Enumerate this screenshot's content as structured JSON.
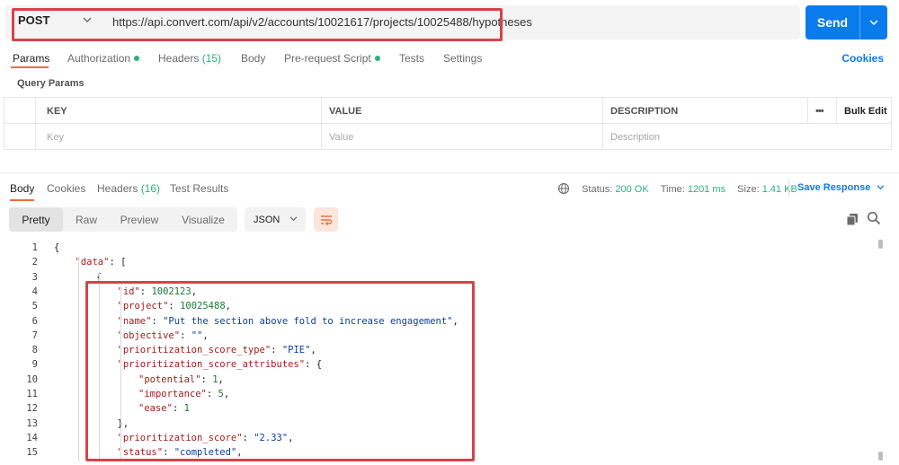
{
  "request": {
    "method": "POST",
    "url": "https://api.convert.com/api/v2/accounts/10021617/projects/10025488/hypotheses",
    "send_label": "Send"
  },
  "request_tabs": [
    {
      "label": "Params",
      "active": true
    },
    {
      "label": "Authorization",
      "dot": true
    },
    {
      "label": "Headers",
      "count": "(15)"
    },
    {
      "label": "Body"
    },
    {
      "label": "Pre-request Script",
      "dot": true
    },
    {
      "label": "Tests"
    },
    {
      "label": "Settings"
    }
  ],
  "cookies_label": "Cookies",
  "query_params": {
    "title": "Query Params",
    "columns": [
      "KEY",
      "VALUE",
      "DESCRIPTION"
    ],
    "more": "•••",
    "bulk_edit": "Bulk Edit",
    "placeholders": [
      "Key",
      "Value",
      "Description"
    ]
  },
  "response_tabs": [
    {
      "label": "Body",
      "active": true
    },
    {
      "label": "Cookies"
    },
    {
      "label": "Headers",
      "count": "(16)"
    },
    {
      "label": "Test Results"
    }
  ],
  "response_status": {
    "status_label": "Status:",
    "status_value": "200 OK",
    "time_label": "Time:",
    "time_value": "1201 ms",
    "size_label": "Size:",
    "size_value": "1.41 KB",
    "save_label": "Save Response"
  },
  "views": [
    "Pretty",
    "Raw",
    "Preview",
    "Visualize"
  ],
  "format": "JSON",
  "code_lines": [
    {
      "n": "1",
      "indent": 0,
      "parts": [
        [
          "p",
          "{"
        ]
      ]
    },
    {
      "n": "2",
      "indent": 1,
      "parts": [
        [
          "k",
          "\"data\""
        ],
        [
          "p",
          ": ["
        ]
      ]
    },
    {
      "n": "3",
      "indent": 2,
      "parts": [
        [
          "p",
          "{"
        ]
      ]
    },
    {
      "n": "4",
      "indent": 3,
      "parts": [
        [
          "k",
          "\"id\""
        ],
        [
          "p",
          ": "
        ],
        [
          "n",
          "1002123"
        ],
        [
          "p",
          ","
        ]
      ]
    },
    {
      "n": "5",
      "indent": 3,
      "parts": [
        [
          "k",
          "\"project\""
        ],
        [
          "p",
          ": "
        ],
        [
          "n",
          "10025488"
        ],
        [
          "p",
          ","
        ]
      ]
    },
    {
      "n": "6",
      "indent": 3,
      "parts": [
        [
          "k",
          "\"name\""
        ],
        [
          "p",
          ": "
        ],
        [
          "s",
          "\"Put the section above fold to increase engagement\""
        ],
        [
          "p",
          ","
        ]
      ]
    },
    {
      "n": "7",
      "indent": 3,
      "parts": [
        [
          "k",
          "\"objective\""
        ],
        [
          "p",
          ": "
        ],
        [
          "s",
          "\"\""
        ],
        [
          "p",
          ","
        ]
      ]
    },
    {
      "n": "8",
      "indent": 3,
      "parts": [
        [
          "k",
          "\"prioritization_score_type\""
        ],
        [
          "p",
          ": "
        ],
        [
          "s",
          "\"PIE\""
        ],
        [
          "p",
          ","
        ]
      ]
    },
    {
      "n": "9",
      "indent": 3,
      "parts": [
        [
          "k",
          "\"prioritization_score_attributes\""
        ],
        [
          "p",
          ": {"
        ]
      ]
    },
    {
      "n": "10",
      "indent": 4,
      "parts": [
        [
          "k",
          "\"potential\""
        ],
        [
          "p",
          ": "
        ],
        [
          "n",
          "1"
        ],
        [
          "p",
          ","
        ]
      ]
    },
    {
      "n": "11",
      "indent": 4,
      "parts": [
        [
          "k",
          "\"importance\""
        ],
        [
          "p",
          ": "
        ],
        [
          "n",
          "5"
        ],
        [
          "p",
          ","
        ]
      ]
    },
    {
      "n": "12",
      "indent": 4,
      "parts": [
        [
          "k",
          "\"ease\""
        ],
        [
          "p",
          ": "
        ],
        [
          "n",
          "1"
        ]
      ]
    },
    {
      "n": "13",
      "indent": 3,
      "parts": [
        [
          "p",
          "},"
        ]
      ]
    },
    {
      "n": "14",
      "indent": 3,
      "parts": [
        [
          "k",
          "\"prioritization_score\""
        ],
        [
          "p",
          ": "
        ],
        [
          "s",
          "\"2.33\""
        ],
        [
          "p",
          ","
        ]
      ]
    },
    {
      "n": "15",
      "indent": 3,
      "parts": [
        [
          "k",
          "\"status\""
        ],
        [
          "p",
          ": "
        ],
        [
          "s",
          "\"completed\""
        ],
        [
          "p",
          ","
        ]
      ]
    }
  ],
  "colors": {
    "accent": "#097bed",
    "active_tab": "#f26b3a",
    "success": "#26b47f",
    "highlight_box": "#d8424a"
  }
}
